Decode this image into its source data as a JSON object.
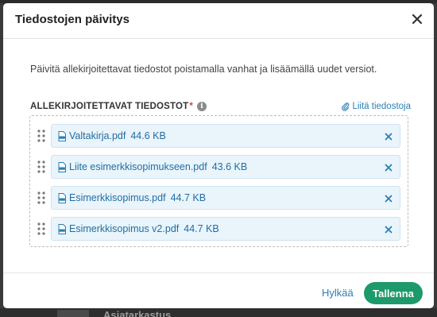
{
  "dialog": {
    "title": "Tiedostojen päivitys",
    "description": "Päivitä allekirjoitettavat tiedostot poistamalla vanhat ja lisäämällä uudet versiot.",
    "section_label": "ALLEKIRJOITETTAVAT TIEDOSTOT",
    "required_mark": "*",
    "info_icon_glyph": "i",
    "attach_label": "Liitä tiedostoja",
    "files": [
      {
        "name": "Valtakirja.pdf",
        "size": "44.6 KB"
      },
      {
        "name": "Liite esimerkkisopimukseen.pdf",
        "size": "43.6 KB"
      },
      {
        "name": "Esimerkkisopimus.pdf",
        "size": "44.7 KB"
      },
      {
        "name": "Esimerkkisopimus v2.pdf",
        "size": "44.7 KB"
      }
    ],
    "cancel_label": "Hylkää",
    "save_label": "Tallenna"
  },
  "background": {
    "partial_heading": "Asiatarkastus"
  },
  "colors": {
    "accent_link": "#2b7fb3",
    "primary_button": "#1e9a6a",
    "file_chip_bg": "#eaf4fb",
    "required": "#d0433b"
  },
  "icons": {
    "close": "close-icon",
    "info": "info-icon",
    "attach": "paperclip-icon",
    "drag": "drag-handle-icon",
    "file": "pdf-file-icon",
    "remove": "remove-icon"
  }
}
